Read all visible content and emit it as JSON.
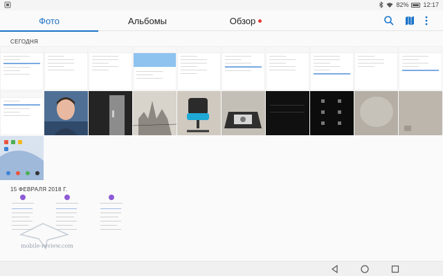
{
  "status_bar": {
    "battery": "82%",
    "time": "12:17"
  },
  "tabs": [
    {
      "label": "Фото",
      "active": true
    },
    {
      "label": "Альбомы",
      "active": false
    },
    {
      "label": "Обзор",
      "active": false,
      "badge": true
    }
  ],
  "toolbar_icons": [
    "search-icon",
    "map-icon",
    "more-icon"
  ],
  "sections": {
    "today": {
      "title": "СЕГОДНЯ"
    },
    "feb": {
      "title": "15 ФЕВРАЛЯ 2018 Г."
    }
  },
  "colors": {
    "accent": "#1a73c9",
    "badge": "#e53935"
  },
  "watermark": {
    "text": "mobile-review.com"
  },
  "nav_icons": [
    "back-icon",
    "home-icon",
    "recents-icon"
  ]
}
